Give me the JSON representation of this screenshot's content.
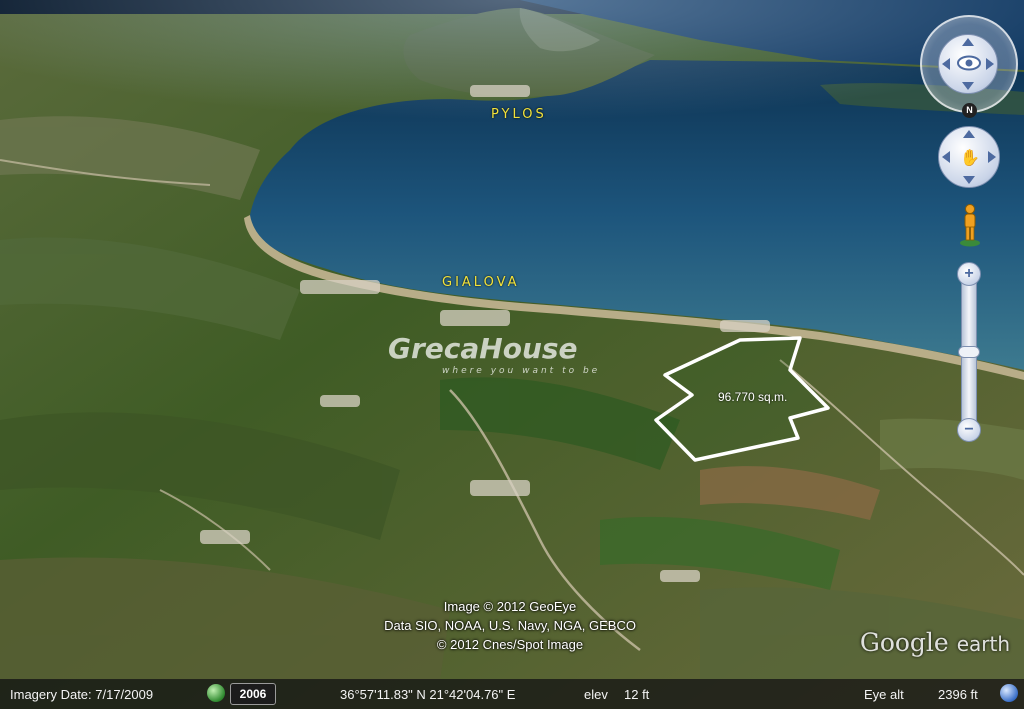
{
  "map": {
    "places": [
      "PYLOS",
      "GIALOVA"
    ],
    "parcel_area_label": "96.770 sq.m.",
    "watermark": {
      "brand": "GrecaHouse",
      "tagline": "where you want to be"
    },
    "credits": [
      "Image © 2012 GeoEye",
      "Data SIO, NOAA, U.S. Navy, NGA, GEBCO",
      "© 2012 Cnes/Spot Image"
    ],
    "logo": {
      "google": "Google",
      "earth": "earth"
    },
    "colors": {
      "sea": "#1f5b86",
      "land": "#4a6a2a",
      "label": "#f2e23a",
      "parcel_outline": "#ffffff"
    }
  },
  "controls": {
    "north_label": "N",
    "zoom_in": "+",
    "zoom_out": "−",
    "icons": [
      "look-joystick-icon",
      "move-joystick-icon",
      "street-view-pegman-icon",
      "zoom-slider"
    ]
  },
  "statusbar": {
    "imagery_date": "Imagery Date: 7/17/2009",
    "year_button": "2006",
    "coordinates": "36°57'11.83\" N  21°42'04.76\" E",
    "elev_label": "elev",
    "elev_value": "12 ft",
    "eye_alt_label": "Eye alt",
    "eye_alt_value": "2396 ft"
  }
}
